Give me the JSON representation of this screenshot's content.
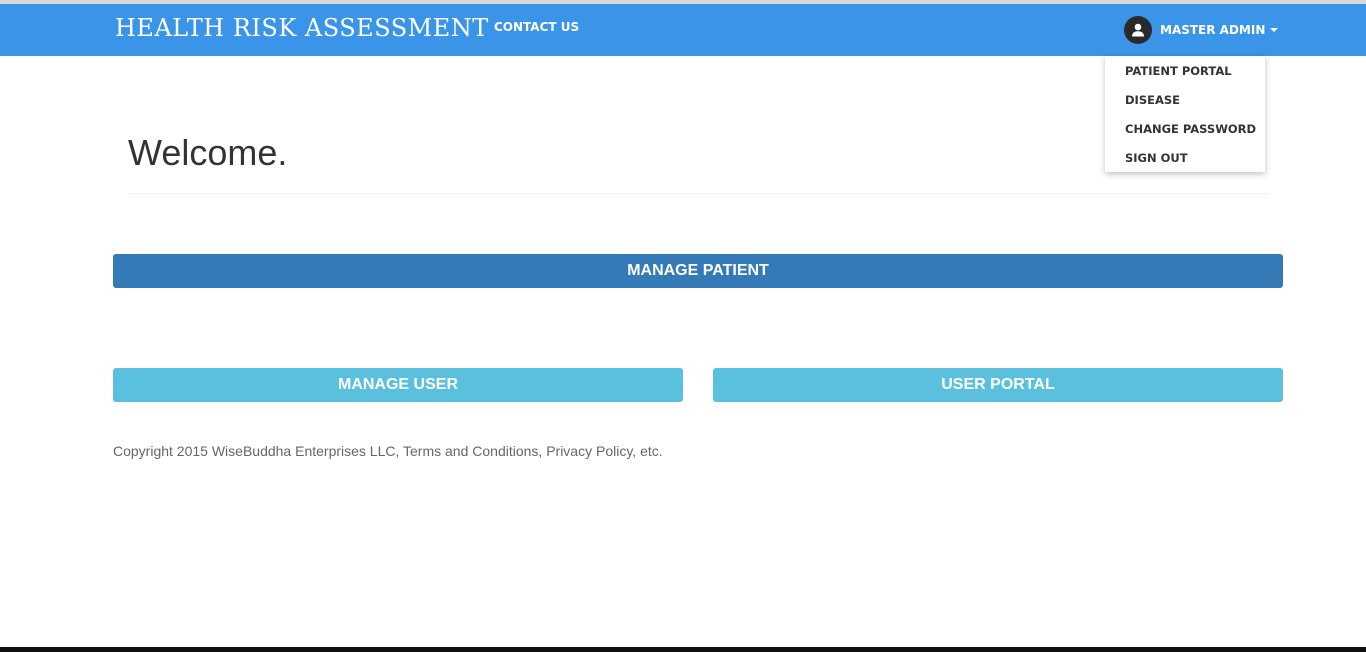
{
  "navbar": {
    "brand": "HEALTH RISK ASSESSMENT",
    "links": [
      {
        "label": "CONTACT US"
      }
    ],
    "user": {
      "name": "MASTER ADMIN",
      "avatar_icon": "user-avatar-icon",
      "caret_icon": "caret-down-icon"
    }
  },
  "dropdown": {
    "items": [
      {
        "label": "PATIENT PORTAL"
      },
      {
        "label": "DISEASE"
      },
      {
        "label": "CHANGE PASSWORD"
      },
      {
        "label": "SIGN OUT"
      }
    ]
  },
  "main": {
    "heading": "Welcome.",
    "buttons": {
      "manage_patient": "MANAGE PATIENT",
      "manage_user": "MANAGE USER",
      "user_portal": "USER PORTAL"
    },
    "footer": "Copyright 2015 WiseBuddha Enterprises LLC, Terms and Conditions, Privacy Policy, etc."
  },
  "colors": {
    "navbar": "#3a94e8",
    "primary_button": "#337ab7",
    "info_button": "#5bc0de"
  }
}
